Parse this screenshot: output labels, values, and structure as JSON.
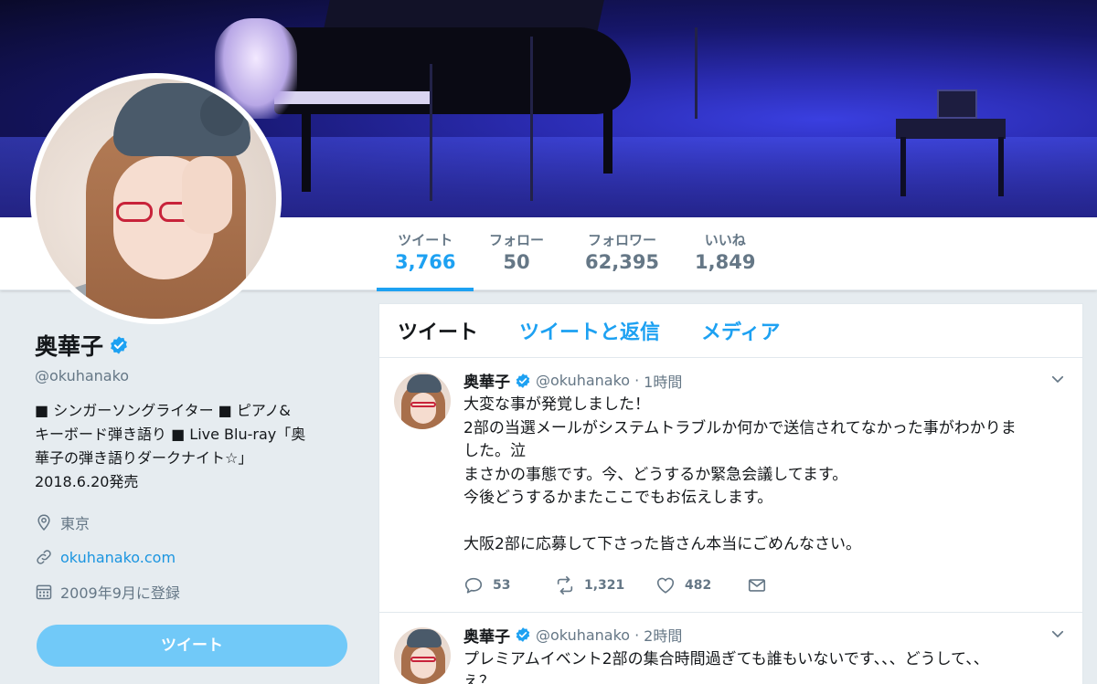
{
  "profile": {
    "name": "奥華子",
    "handle": "@okuhanako",
    "bio": "■ シンガーソングライター ■ ピアノ&\nキーボード弾き語り ■ Live Blu-ray「奥\n華子の弾き語りダークナイト☆」\n2018.6.20発売",
    "location": "東京",
    "url": "okuhanako.com",
    "joined": "2009年9月に登録",
    "tweet_button": "ツイート"
  },
  "stats": [
    {
      "label": "ツイート",
      "value": "3,766"
    },
    {
      "label": "フォロー",
      "value": "50"
    },
    {
      "label": "フォロワー",
      "value": "62,395"
    },
    {
      "label": "いいね",
      "value": "1,849"
    }
  ],
  "tabs": [
    "ツイート",
    "ツイートと返信",
    "メディア"
  ],
  "tweets": [
    {
      "name": "奥華子",
      "handle": "@okuhanako",
      "time": "1時間",
      "text": "大変な事が発覚しました！\n2部の当選メールがシステムトラブルか何かで送信されてなかった事がわかりま\nした。泣\nまさかの事態です。今、どうするか緊急会議してます。\n今後どうするかまたここでもお伝えします。\n\n大阪2部に応募して下さった皆さん本当にごめんなさい。",
      "replies": "53",
      "retweets": "1,321",
      "likes": "482"
    },
    {
      "name": "奥華子",
      "handle": "@okuhanako",
      "time": "2時間",
      "text": "プレミアムイベント2部の集合時間過ぎても誰もいないです、、、どうして、、\nえ？"
    }
  ],
  "colors": {
    "accent": "#1da1f2",
    "button": "#71c9f8",
    "verified": "#1da1f2"
  }
}
